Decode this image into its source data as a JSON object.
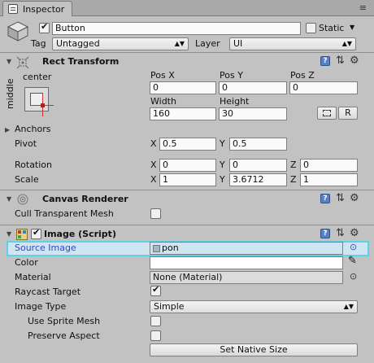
{
  "tab": {
    "label": "Inspector",
    "menu": "≡"
  },
  "header": {
    "active": true,
    "name": "Button",
    "static_label": "Static",
    "static_checked": false,
    "tag_label": "Tag",
    "tag_value": "Untagged",
    "layer_label": "Layer",
    "layer_value": "UI"
  },
  "rect_transform": {
    "title": "Rect Transform",
    "anchor_h": "center",
    "anchor_v": "middle",
    "pos_x_label": "Pos X",
    "pos_y_label": "Pos Y",
    "pos_z_label": "Pos Z",
    "pos_x": "0",
    "pos_y": "0",
    "pos_z": "0",
    "width_label": "Width",
    "height_label": "Height",
    "width": "160",
    "height": "30",
    "r_button": "R",
    "anchors_label": "Anchors",
    "pivot_label": "Pivot",
    "pivot_x": "0.5",
    "pivot_y": "0.5",
    "rotation_label": "Rotation",
    "rot_x": "0",
    "rot_y": "0",
    "rot_z": "0",
    "scale_label": "Scale",
    "scale_x": "1",
    "scale_y": "3.6712",
    "scale_z": "1",
    "x": "X",
    "y": "Y",
    "z": "Z"
  },
  "canvas_renderer": {
    "title": "Canvas Renderer",
    "cull_label": "Cull Transparent Mesh",
    "cull_checked": false
  },
  "image": {
    "title": "Image (Script)",
    "enabled": true,
    "source_label": "Source Image",
    "source_value": "pon",
    "color_label": "Color",
    "color_value": "#ffffff",
    "material_label": "Material",
    "material_value": "None (Material)",
    "raycast_label": "Raycast Target",
    "raycast_checked": true,
    "image_type_label": "Image Type",
    "image_type_value": "Simple",
    "use_sprite_mesh_label": "Use Sprite Mesh",
    "use_sprite_mesh_checked": false,
    "preserve_aspect_label": "Preserve Aspect",
    "preserve_aspect_checked": false,
    "native_size_button": "Set Native Size"
  },
  "colors": {
    "highlight": "#5fd0e6",
    "accent_blue": "#3845c8",
    "anchor_red": "#d03030"
  }
}
